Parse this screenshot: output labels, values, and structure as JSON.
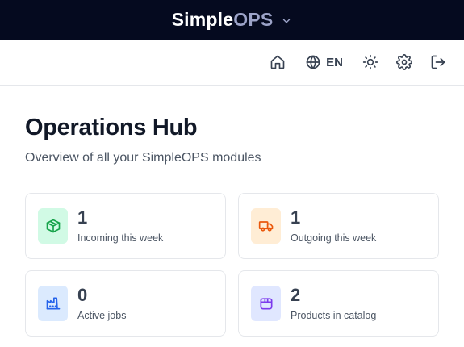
{
  "brand": {
    "name_main": "Simple",
    "name_accent": "OPS"
  },
  "toolbar": {
    "language": "EN"
  },
  "page": {
    "title": "Operations Hub",
    "subtitle": "Overview of all your SimpleOPS modules"
  },
  "cards": [
    {
      "value": "1",
      "label": "Incoming this week",
      "icon": "box-icon",
      "color": "#16a34a",
      "bg": "#d1fae5"
    },
    {
      "value": "1",
      "label": "Outgoing this week",
      "icon": "truck-icon",
      "color": "#ea580c",
      "bg": "#ffedd5"
    },
    {
      "value": "0",
      "label": "Active jobs",
      "icon": "factory-icon",
      "color": "#2563eb",
      "bg": "#dbeafe"
    },
    {
      "value": "2",
      "label": "Products in catalog",
      "icon": "package-icon",
      "color": "#7c3aed",
      "bg": "#e0e7ff"
    }
  ],
  "colors": {
    "topbar": "#050a1f",
    "accent": "#9ca3c8"
  }
}
